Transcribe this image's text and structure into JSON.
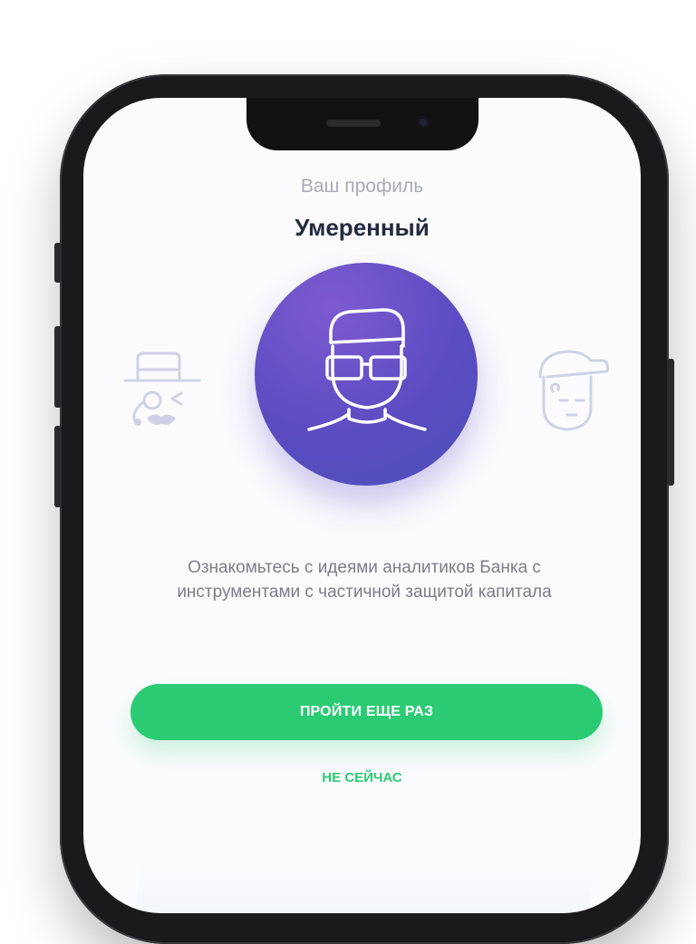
{
  "profile": {
    "subtitle": "Ваш профиль",
    "title": "Умеренный",
    "description": "Ознакомьтесь с идеями аналитиков Банка с инструментами с частичной защитой капитала"
  },
  "actions": {
    "retry_label": "ПРОЙТИ ЕЩЕ РАЗ",
    "later_label": "НЕ СЕЙЧАС"
  },
  "carousel": {
    "left_avatar_icon": "hat-monocle-mustache-icon",
    "selected_avatar_icon": "sunglasses-person-icon",
    "right_avatar_icon": "cap-face-icon"
  },
  "colors": {
    "accent_green": "#2bcb73",
    "avatar_purple": "#5c4cc2",
    "title_dark": "#242a3f",
    "subtitle_gray": "#a9abb6",
    "text_gray": "#7b7d89"
  }
}
